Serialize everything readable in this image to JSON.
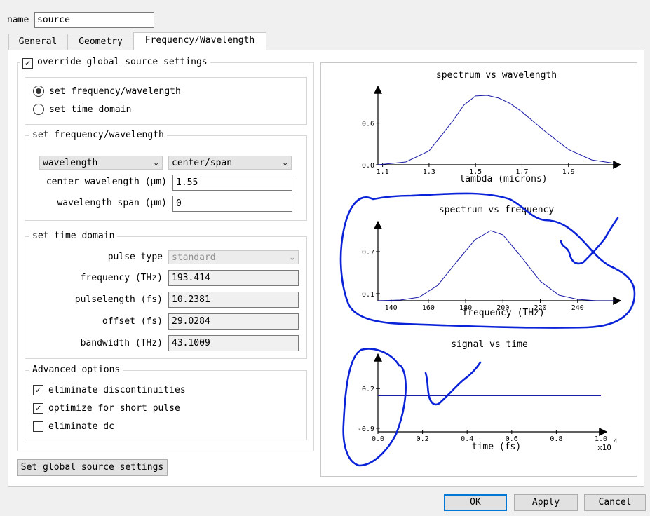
{
  "name_field": {
    "label": "name",
    "value": "source"
  },
  "tabs": [
    {
      "label": "General"
    },
    {
      "label": "Geometry"
    },
    {
      "label": "Frequency/Wavelength"
    }
  ],
  "override": {
    "label": "override global source settings",
    "checked": true
  },
  "mode": {
    "options": [
      {
        "label": "set frequency/wavelength",
        "selected": true
      },
      {
        "label": "set time domain",
        "selected": false
      }
    ]
  },
  "freq_group": {
    "title": "set frequency/wavelength",
    "type_select": "wavelength",
    "range_select": "center/span",
    "center_label": "center wavelength (μm)",
    "center_value": "1.55",
    "span_label": "wavelength span (μm)",
    "span_value": "0"
  },
  "time_group": {
    "title": "set time domain",
    "pulse_type_label": "pulse type",
    "pulse_type_value": "standard",
    "frequency_label": "frequency (THz)",
    "frequency_value": "193.414",
    "pulselength_label": "pulselength (fs)",
    "pulselength_value": "10.2381",
    "offset_label": "offset (fs)",
    "offset_value": "29.0284",
    "bandwidth_label": "bandwidth (THz)",
    "bandwidth_value": "43.1009"
  },
  "advanced": {
    "title": "Advanced options",
    "options": [
      {
        "label": "eliminate discontinuities",
        "checked": true
      },
      {
        "label": "optimize for short pulse",
        "checked": true
      },
      {
        "label": "eliminate dc",
        "checked": false
      }
    ]
  },
  "global_button": "Set global source settings",
  "footer": {
    "ok": "OK",
    "apply": "Apply",
    "cancel": "Cancel"
  },
  "colors": {
    "curve": "#1a1aa6",
    "annotation": "#0a22d8",
    "accent": "#0078d7"
  },
  "chart_data": [
    {
      "type": "line",
      "title": "spectrum vs wavelength",
      "xlabel": "lambda (microns)",
      "ylabel": "",
      "xticks": [
        "1.1",
        "1.3",
        "1.5",
        "1.7",
        "1.9"
      ],
      "yticks": [
        "0.0",
        "0.6"
      ],
      "xlim": [
        1.08,
        2.1
      ],
      "ylim": [
        0,
        1.05
      ],
      "series": [
        {
          "x": [
            1.08,
            1.2,
            1.3,
            1.4,
            1.45,
            1.5,
            1.55,
            1.6,
            1.65,
            1.7,
            1.8,
            1.9,
            2.0,
            2.1
          ],
          "values": [
            0.0,
            0.04,
            0.2,
            0.62,
            0.86,
            0.99,
            1.0,
            0.96,
            0.88,
            0.76,
            0.48,
            0.22,
            0.07,
            0.02
          ]
        }
      ]
    },
    {
      "type": "line",
      "title": "spectrum vs frequency",
      "xlabel": "frequency (THz)",
      "ylabel": "",
      "xticks": [
        "140",
        "160",
        "180",
        "200",
        "220",
        "240"
      ],
      "yticks": [
        "0.1",
        "0.7"
      ],
      "xlim": [
        133,
        260
      ],
      "ylim": [
        0,
        1.05
      ],
      "series": [
        {
          "x": [
            133,
            145,
            155,
            165,
            175,
            185,
            193.4,
            200,
            210,
            220,
            230,
            240,
            250,
            260
          ],
          "values": [
            0.0,
            0.01,
            0.05,
            0.22,
            0.55,
            0.87,
            1.0,
            0.94,
            0.62,
            0.28,
            0.08,
            0.02,
            0.0,
            0.0
          ]
        }
      ]
    },
    {
      "type": "line",
      "title": "signal vs time",
      "xlabel": "time (fs)",
      "ylabel": "",
      "xticks": [
        "0.0",
        "0.2",
        "0.4",
        "0.6",
        "0.8",
        "1.0"
      ],
      "yticks": [
        "-0.9",
        "0.2"
      ],
      "x_exponent": "x10 4",
      "xlim": [
        0,
        1.0
      ],
      "ylim": [
        -1.0,
        1.0
      ],
      "series": [
        {
          "x": [
            0,
            1.0
          ],
          "values": [
            0.0,
            0.0
          ]
        }
      ]
    }
  ]
}
